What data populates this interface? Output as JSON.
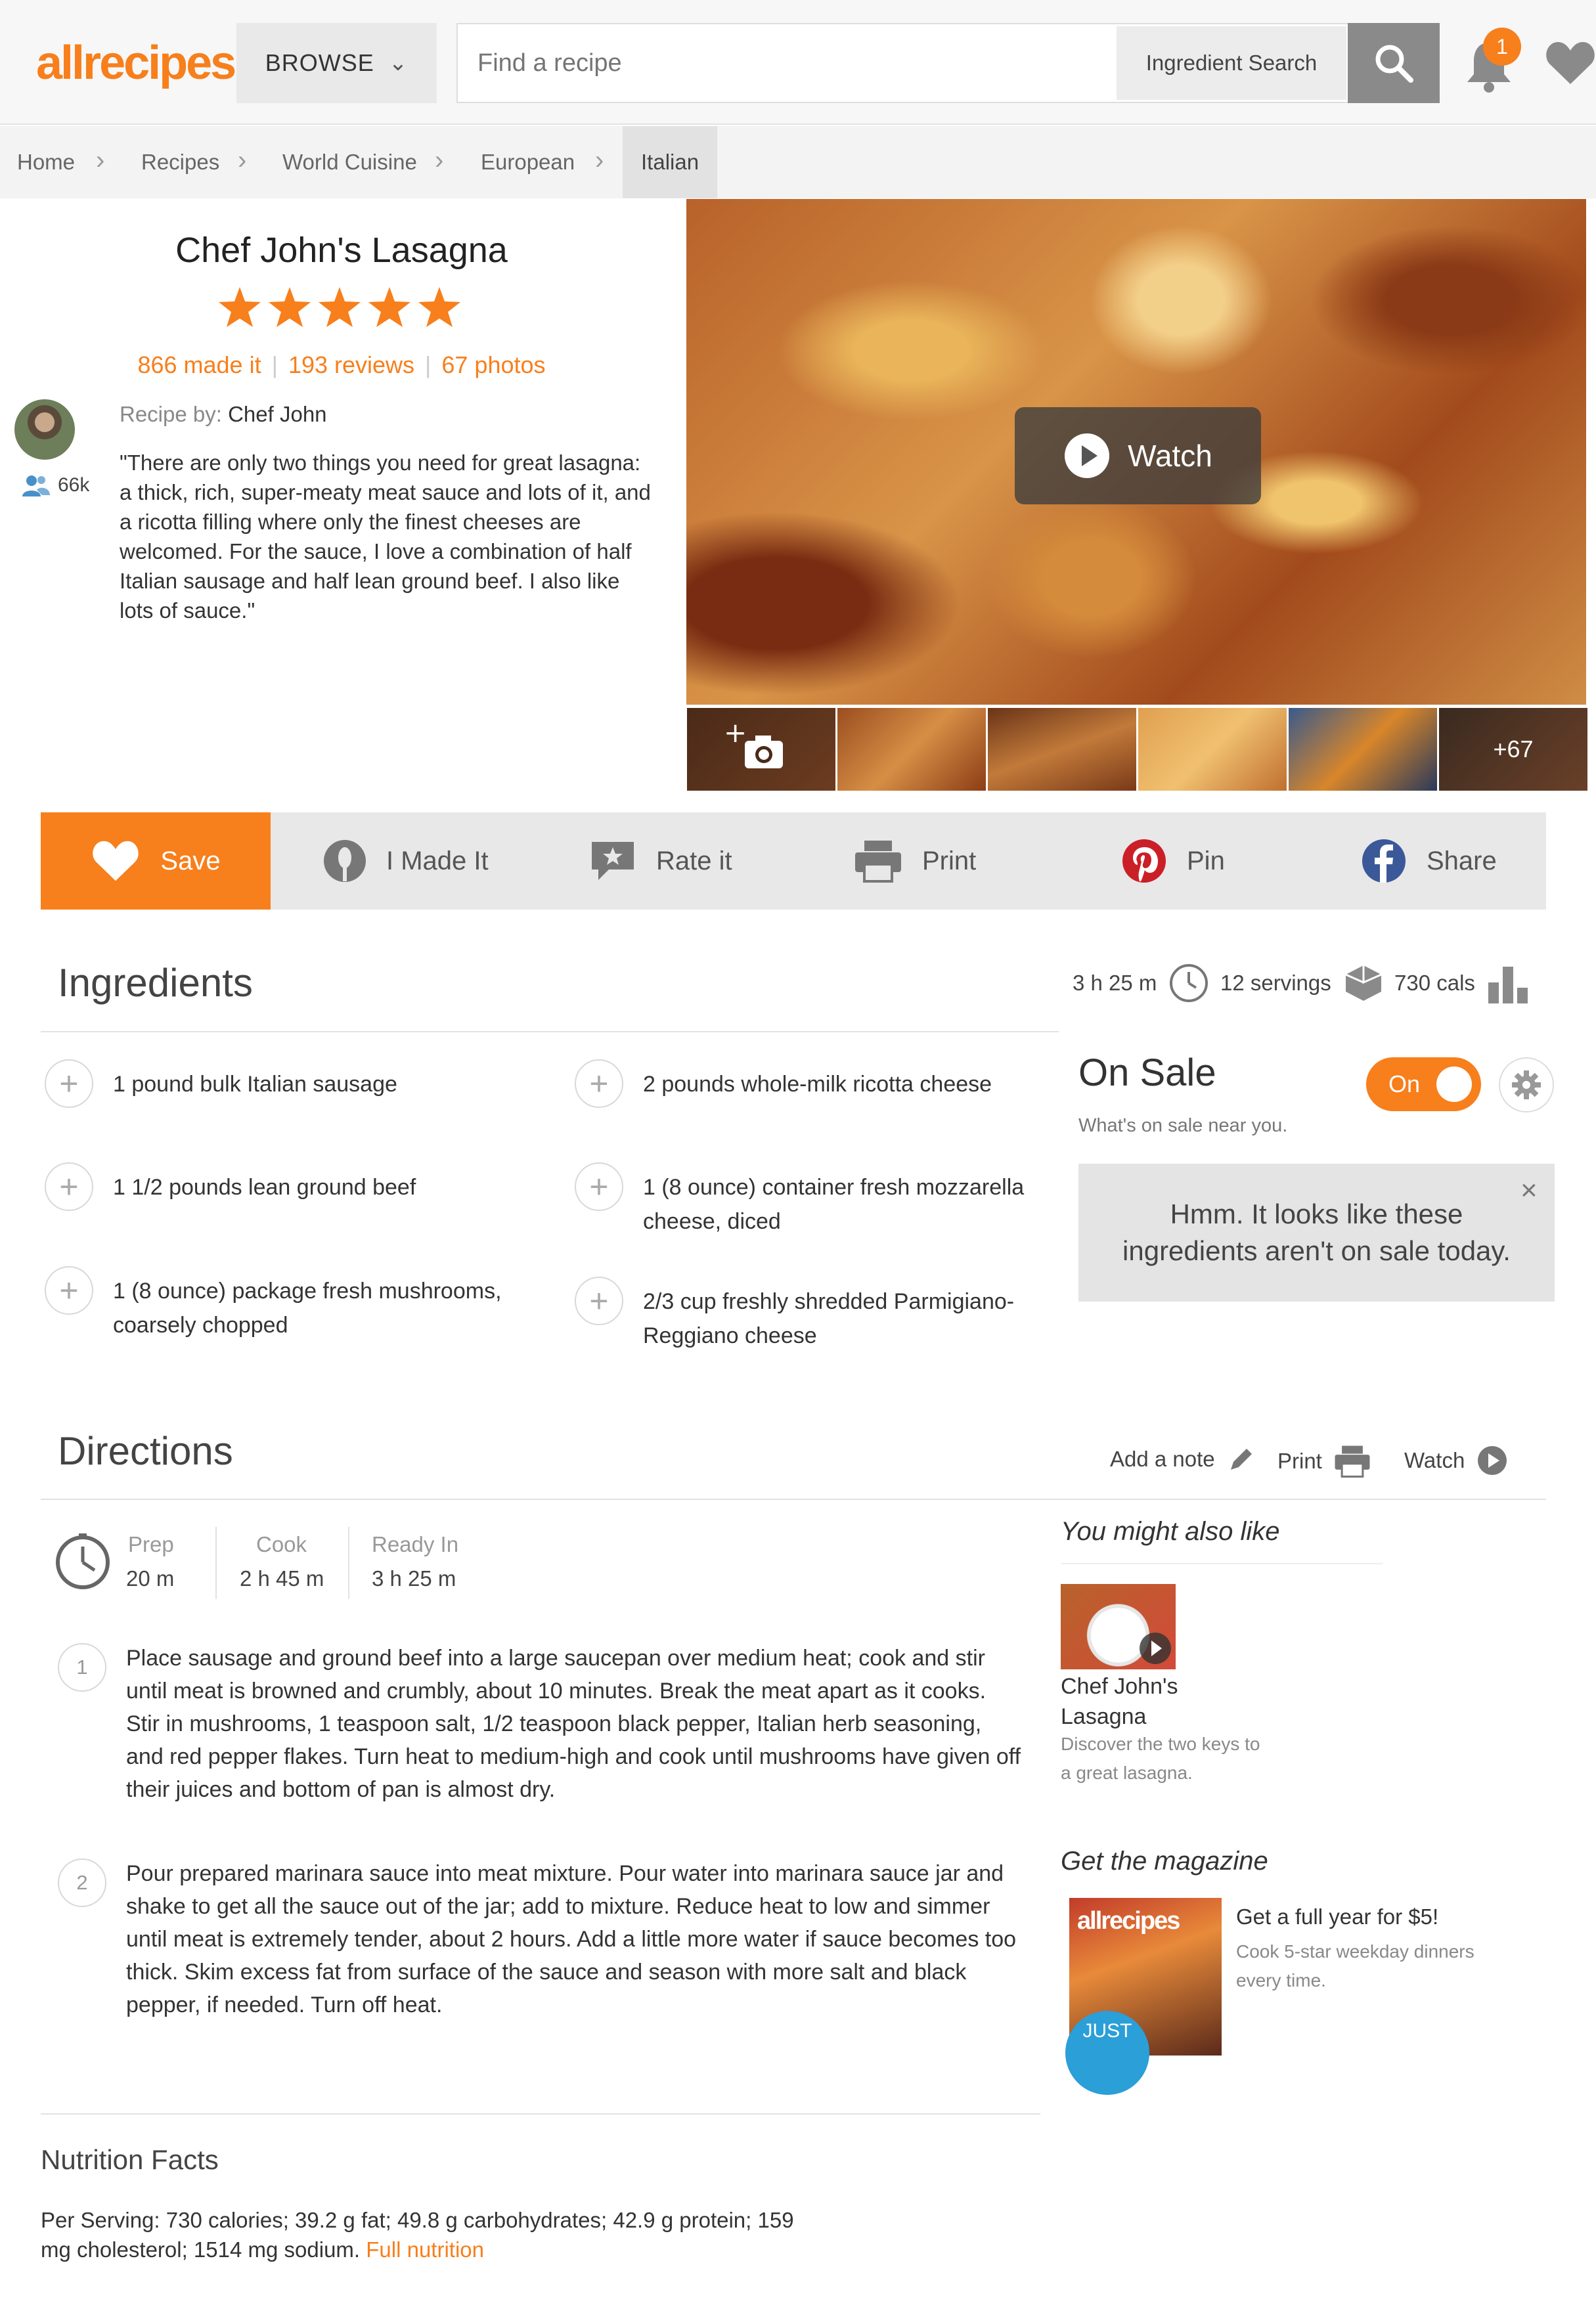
{
  "header": {
    "logo": "allrecipes",
    "browse_label": "BROWSE",
    "search_placeholder": "Find a recipe",
    "ingredient_search_label": "Ingredient Search",
    "notification_count": "1"
  },
  "breadcrumb": [
    "Home",
    "Recipes",
    "World Cuisine",
    "European",
    "Italian"
  ],
  "recipe": {
    "title": "Chef John's Lasagna",
    "rating_stars": 5,
    "made_it": "866 made it",
    "reviews": "193 reviews",
    "photos": "67 photos",
    "recipe_by_label": "Recipe by:",
    "author": "Chef John",
    "followers": "66k",
    "quote": "\"There are only two things you need for great lasagna: a thick, rich, super-meaty meat sauce and lots of it, and a ricotta filling where only the finest cheeses are welcomed. For the sauce, I love a combination of half Italian sausage and half lean ground beef. I also like lots of sauce.\"",
    "watch_label": "Watch",
    "more_photos": "+67"
  },
  "actions": {
    "save": "Save",
    "made_it": "I Made It",
    "rate": "Rate it",
    "print": "Print",
    "pin": "Pin",
    "share": "Share"
  },
  "ingredients": {
    "heading": "Ingredients",
    "time": "3 h 25 m",
    "servings": "12 servings",
    "calories": "730 cals",
    "left": [
      "1 pound bulk Italian sausage",
      "1 1/2 pounds lean ground beef",
      "1 (8 ounce) package fresh mushrooms, coarsely chopped"
    ],
    "right": [
      "2 pounds whole-milk ricotta cheese",
      "1 (8 ounce) container fresh mozzarella cheese, diced",
      "2/3 cup freshly shredded Parmigiano-Reggiano cheese"
    ]
  },
  "on_sale": {
    "title": "On Sale",
    "subtitle": "What's on sale near you.",
    "toggle_label": "On",
    "message": "Hmm. It looks like these ingredients aren't on sale today."
  },
  "directions": {
    "heading": "Directions",
    "add_note": "Add a note",
    "print": "Print",
    "watch": "Watch",
    "prep_label": "Prep",
    "prep_value": "20 m",
    "cook_label": "Cook",
    "cook_value": "2 h 45 m",
    "ready_label": "Ready In",
    "ready_value": "3 h 25 m",
    "steps": [
      "Place sausage and ground beef into a large saucepan over medium heat; cook and stir until meat is browned and crumbly, about 10 minutes. Break the meat apart as it cooks. Stir in mushrooms, 1 teaspoon salt, 1/2 teaspoon black pepper, Italian herb seasoning, and red pepper flakes. Turn heat to medium-high and cook until mushrooms have given off their juices and bottom of pan is almost dry.",
      "Pour prepared marinara sauce into meat mixture. Pour water into marinara sauce jar and shake to get all the sauce out of the jar; add to mixture. Reduce heat to low and simmer until meat is extremely tender, about 2 hours. Add a little more water if sauce becomes too thick. Skim excess fat from surface of the sauce and season with more salt and black pepper, if needed. Turn off heat."
    ]
  },
  "sidebar": {
    "also_like_heading": "You might also like",
    "rec_title": "Chef John's Lasagna",
    "rec_desc": "Discover the two keys to a great lasagna.",
    "magazine_heading": "Get the magazine",
    "magazine_offer": "Get a full year for $5!",
    "magazine_desc": "Cook 5-star weekday dinners every time.",
    "magazine_badge": "JUST"
  },
  "nutrition": {
    "heading": "Nutrition Facts",
    "summary": "Per Serving: 730 calories; 39.2 g fat; 49.8 g carbohydrates; 42.9 g protein; 159 mg cholesterol; 1514 mg sodium.",
    "full_link": "Full nutrition"
  },
  "colors": {
    "brand_orange": "#f77f1c",
    "pinterest_red": "#cb1f27",
    "facebook_blue": "#3b5998"
  }
}
